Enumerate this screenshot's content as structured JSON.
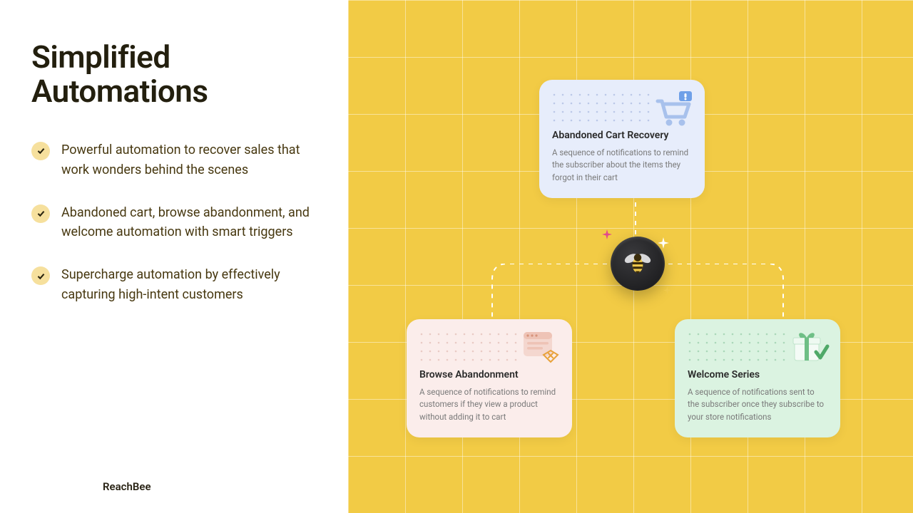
{
  "heading": "Simplified Automations",
  "bullets": [
    "Powerful automation to recover sales that work wonders behind the scenes",
    "Abandoned cart, browse abandonment, and welcome automation with smart triggers",
    "Supercharge automation by effectively capturing high-intent customers"
  ],
  "brand": "ReachBee",
  "cards": {
    "cart": {
      "title": "Abandoned Cart Recovery",
      "desc": "A sequence of notifications to remind the subscriber about the items they forgot in their cart"
    },
    "browse": {
      "title": "Browse Abandonment",
      "desc": "A sequence of notifications to remind customers if they view a product without adding it to cart"
    },
    "welcome": {
      "title": "Welcome Series",
      "desc": "A sequence of notifications sent to the subscriber once they subscribe to your store notifications"
    }
  }
}
